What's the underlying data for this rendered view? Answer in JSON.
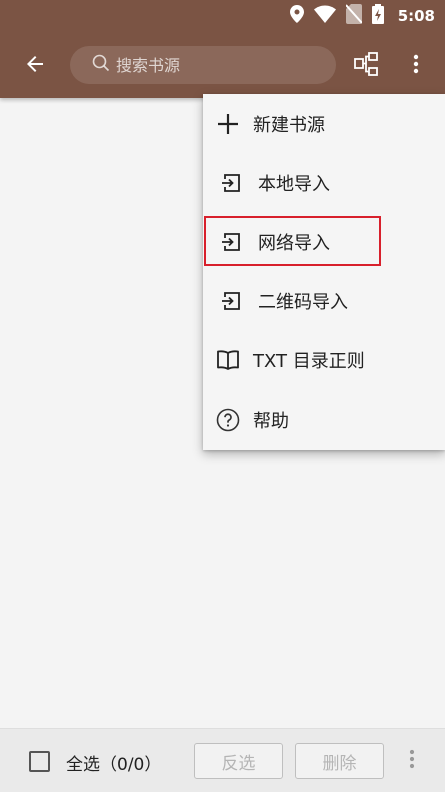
{
  "status_bar": {
    "time": "5:08",
    "icons": [
      "location-icon",
      "wifi-icon",
      "no-sim-icon",
      "battery-charging-icon"
    ]
  },
  "toolbar": {
    "back_icon": "arrow-left-icon",
    "search_placeholder": "搜索书源",
    "search_value": "",
    "group_icon": "group-tree-icon",
    "more_icon": "more-vertical-icon"
  },
  "menu": {
    "items": [
      {
        "label": "新建书源",
        "icon": "plus-icon"
      },
      {
        "label": "本地导入",
        "icon": "import-icon"
      },
      {
        "label": "网络导入",
        "icon": "import-icon",
        "highlighted": true
      },
      {
        "label": "二维码导入",
        "icon": "import-icon"
      },
      {
        "label": "TXT 目录正则",
        "icon": "book-icon"
      },
      {
        "label": "帮助",
        "icon": "help-circle-icon"
      }
    ]
  },
  "bottom_bar": {
    "select_all_label": "全选（0/0）",
    "select_all_checked": false,
    "invert_label": "反选",
    "delete_label": "删除",
    "more_icon": "more-vertical-icon"
  },
  "colors": {
    "appbar": "#7b5444",
    "background": "#f4f4f4",
    "menu_bg": "#f5f5f5",
    "highlight_border": "#d8202c",
    "disabled_text": "#b5b5b5"
  }
}
